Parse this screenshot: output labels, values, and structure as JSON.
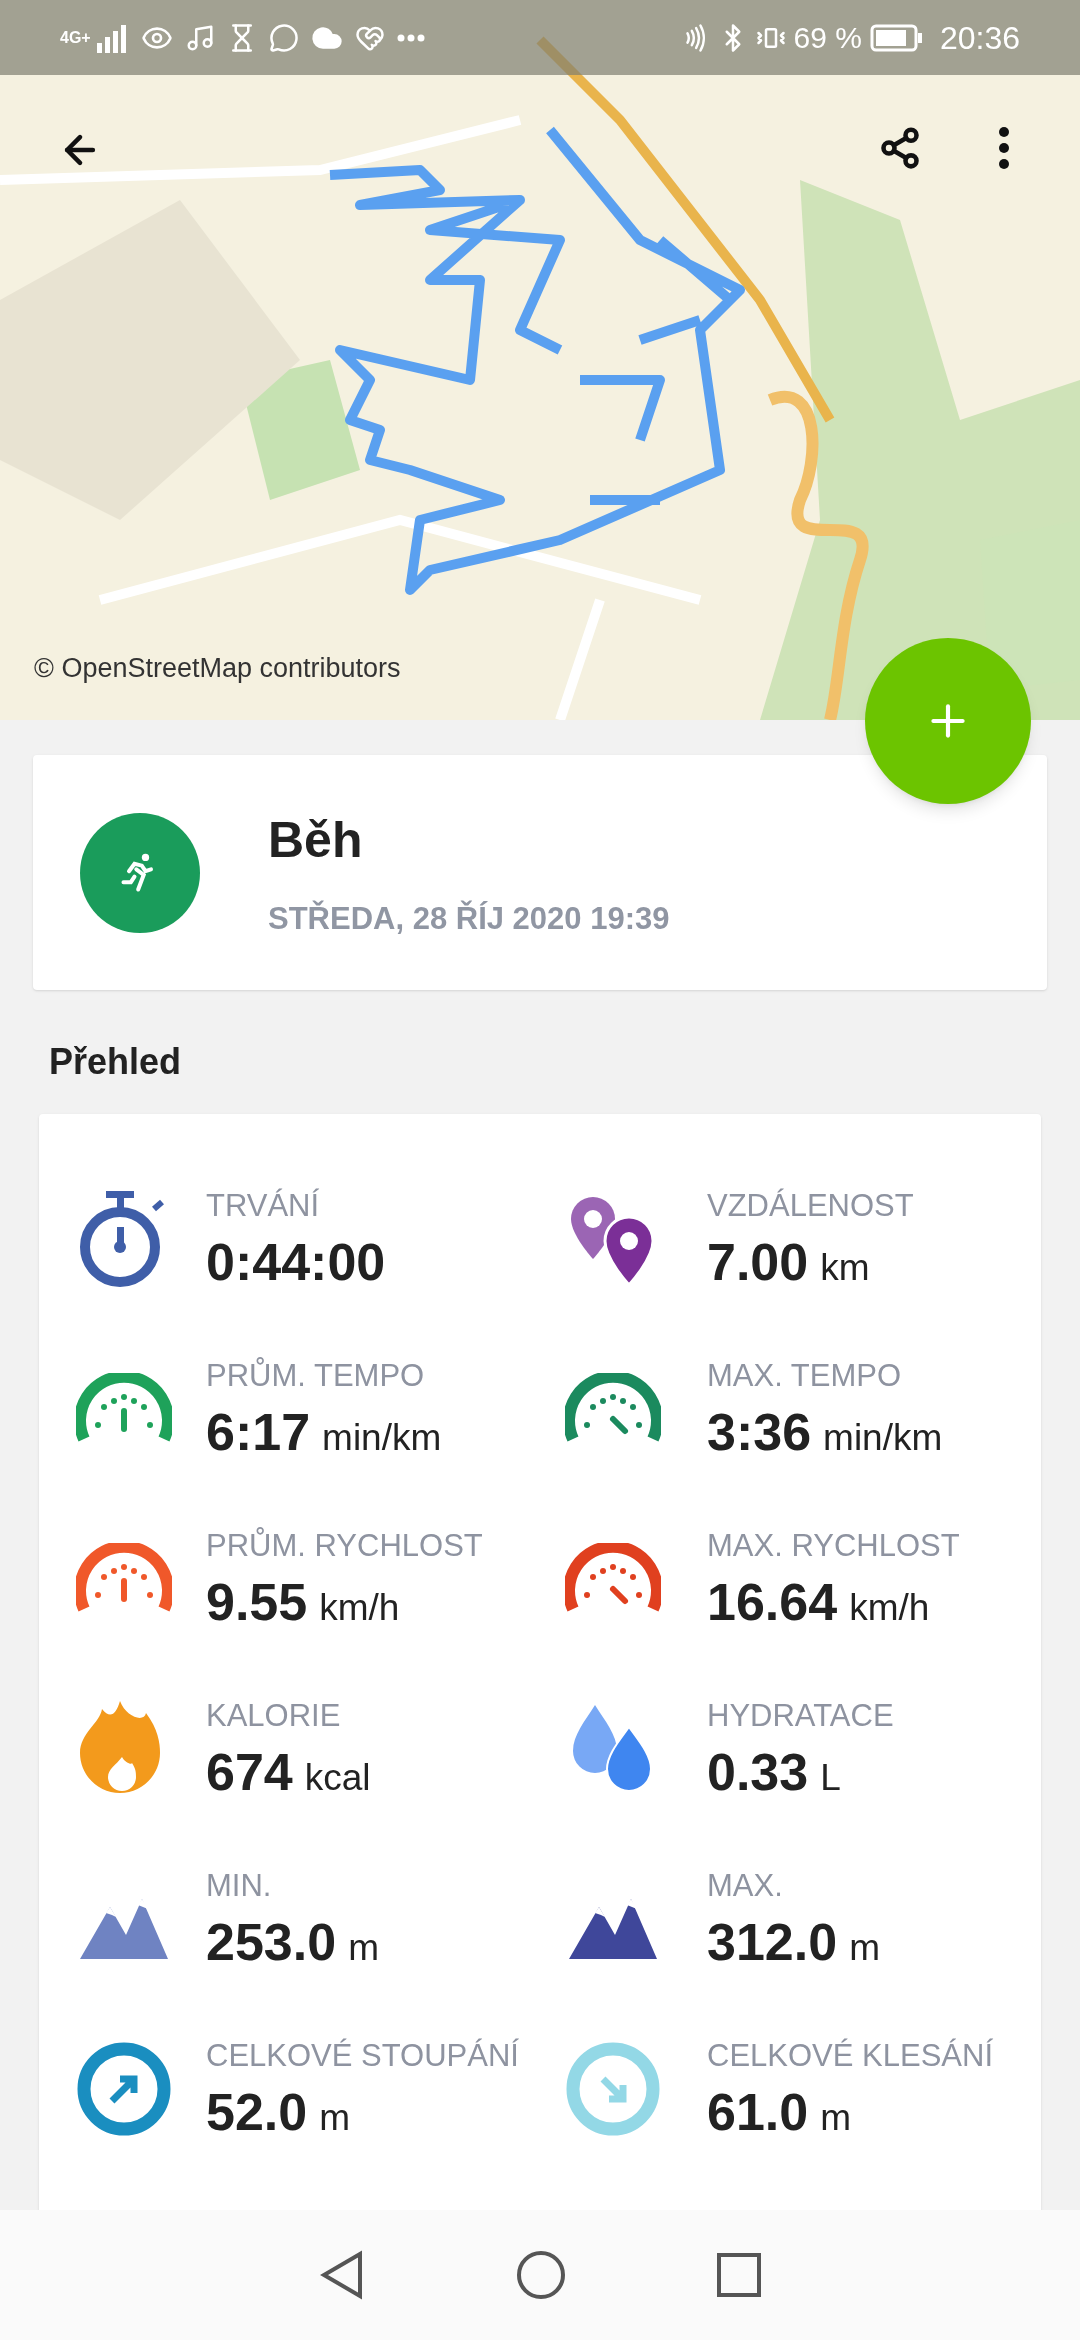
{
  "status_bar": {
    "network": "4G+",
    "battery": "69 %",
    "time": "20:36"
  },
  "map": {
    "attribution": "© OpenStreetMap contributors"
  },
  "activity": {
    "title": "Běh",
    "date": "STŘEDA, 28 ŘÍJ 2020 19:39"
  },
  "overview": {
    "heading": "Přehled",
    "stats": [
      {
        "kind": "stopwatch",
        "label": "TRVÁNÍ",
        "value": "0:44:00"
      },
      {
        "kind": "pins",
        "label": "VZDÁLENOST",
        "value": "7.00",
        "unit": "km"
      },
      {
        "kind": "gauge-avg",
        "label": "PRŮM. TEMPO",
        "value": "6:17",
        "unit": "min/km",
        "color": "#1ea25a"
      },
      {
        "kind": "gauge-max",
        "label": "MAX. TEMPO",
        "value": "3:36",
        "unit": "min/km",
        "color": "#1b8a5e"
      },
      {
        "kind": "gauge-avg",
        "label": "PRŮM. RYCHLOST",
        "value": "9.55",
        "unit": "km/h",
        "color": "#f0582a"
      },
      {
        "kind": "gauge-max",
        "label": "MAX. RYCHLOST",
        "value": "16.64",
        "unit": "km/h",
        "color": "#e0401f"
      },
      {
        "kind": "flame",
        "label": "KALORIE",
        "value": "674",
        "unit": "kcal"
      },
      {
        "kind": "drops",
        "label": "HYDRATACE",
        "value": "0.33",
        "unit": "L"
      },
      {
        "kind": "mountains",
        "label": "MIN.",
        "value": "253.0",
        "unit": "m",
        "color": "#6f83c2"
      },
      {
        "kind": "mountains",
        "label": "MAX.",
        "value": "312.0",
        "unit": "m",
        "color": "#3f479a"
      },
      {
        "kind": "ascent",
        "label": "CELKOVÉ STOUPÁNÍ",
        "value": "52.0",
        "unit": "m",
        "color": "#1a8ec0"
      },
      {
        "kind": "descent",
        "label": "CELKOVÉ KLESÁNÍ",
        "value": "61.0",
        "unit": "m",
        "color": "#93d8e6"
      }
    ]
  }
}
